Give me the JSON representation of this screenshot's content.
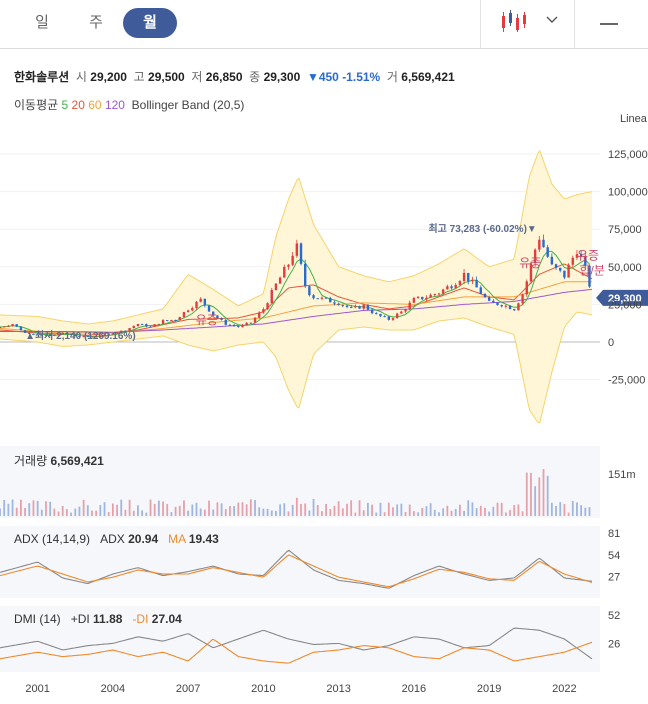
{
  "tabs": [
    {
      "label": "일",
      "active": false
    },
    {
      "label": "주",
      "active": false
    },
    {
      "label": "월",
      "active": true
    }
  ],
  "info": {
    "name": "한화솔루션",
    "open_label": "시",
    "open": "29,200",
    "high_label": "고",
    "high": "29,500",
    "low_label": "저",
    "low": "26,850",
    "close_label": "종",
    "close": "29,300",
    "change": "▼450",
    "change_pct": "-1.51%",
    "volume_label": "거",
    "volume": "6,569,421"
  },
  "ma": {
    "label": "이동평균",
    "periods": [
      "5",
      "20",
      "60",
      "120"
    ],
    "colors": [
      "#3cb44b",
      "#e6553a",
      "#f4a23c",
      "#9b59d0"
    ],
    "bollinger": "Bollinger Band (20,5)"
  },
  "scale_label": "Linea",
  "price_badge": "29,300",
  "volume_panel": {
    "label": "거래량",
    "value": "6,569,421"
  },
  "adx_panel": {
    "label": "ADX (14,14,9)",
    "adx_label": "ADX",
    "adx_value": "20.94",
    "ma_label": "MA",
    "ma_value": "19.43"
  },
  "dmi_panel": {
    "label": "DMI (14)",
    "pdi_label": "+DI",
    "pdi_value": "11.88",
    "mdi_label": "-DI",
    "mdi_value": "27.04"
  },
  "chart_data": [
    {
      "type": "line",
      "title": "",
      "x_ticks": [
        "2001",
        "2004",
        "2007",
        "2010",
        "2013",
        "2016",
        "2019",
        "2022"
      ],
      "y_ticks": [
        "125,000",
        "100,000",
        "75,000",
        "50,000",
        "25,000",
        "0",
        "-25,000"
      ],
      "ylim": [
        -30000,
        130000
      ],
      "annotations": [
        {
          "text": "최고 73,283 (-60.02%)▼",
          "x": 2020.9,
          "y": 73283
        },
        {
          "text": "▲최저 2,140 (1269.16%)",
          "x": 2000.5,
          "y": 2140
        },
        {
          "text": "유증",
          "x": 2007.3,
          "y": 12000
        },
        {
          "text": "유증",
          "x": 2020.2,
          "y": 50000
        },
        {
          "text": "유증",
          "x": 2022.5,
          "y": 55000
        },
        {
          "text": "합/분",
          "x": 2022.6,
          "y": 45000
        }
      ],
      "series": [
        {
          "name": "",
          "x": [
            1999.5,
            2000,
            2000.5,
            2001,
            2001.5,
            2002,
            2002.5,
            2003,
            2003.5,
            2004,
            2004.5,
            2005,
            2005.5,
            2006,
            2006.5,
            2007,
            2007.5,
            2008,
            2008.5,
            2009,
            2009.5,
            2010,
            2010.5,
            2011,
            2011.3,
            2011.7,
            2012,
            2012.5,
            2013,
            2013.5,
            2014,
            2014.5,
            2015,
            2015.5,
            2016,
            2016.5,
            2017,
            2017.5,
            2018,
            2018.5,
            2019,
            2019.5,
            2020,
            2020.4,
            2020.8,
            2021,
            2021.5,
            2022,
            2022.5,
            2022.8,
            2023,
            2023.1
          ],
          "values": [
            10000,
            12000,
            6000,
            5000,
            4000,
            6000,
            4000,
            3500,
            4000,
            6000,
            8000,
            12000,
            10000,
            14000,
            15000,
            22000,
            28000,
            18000,
            12000,
            10000,
            13000,
            22000,
            38000,
            52000,
            65000,
            35000,
            30000,
            28000,
            26000,
            22000,
            24000,
            18000,
            15000,
            20000,
            28000,
            30000,
            33000,
            38000,
            45000,
            36000,
            26000,
            25000,
            22000,
            34000,
            60000,
            70000,
            50000,
            44000,
            62000,
            50000,
            38000,
            29300
          ]
        },
        {
          "name": "",
          "x": [
            1999.5,
            2001,
            2003,
            2005,
            2007,
            2009,
            2010,
            2011,
            2012,
            2013,
            2014,
            2015,
            2016,
            2017,
            2018,
            2019,
            2020,
            2021,
            2022,
            2023.1
          ],
          "values": [
            8000,
            6000,
            4500,
            8000,
            15000,
            16000,
            20000,
            36000,
            38000,
            30000,
            25000,
            22000,
            24000,
            30000,
            36000,
            30000,
            28000,
            45000,
            52000,
            42000
          ]
        },
        {
          "name": "",
          "x": [
            1999.5,
            2002,
            2004,
            2006,
            2008,
            2010,
            2012,
            2014,
            2016,
            2018,
            2020,
            2022,
            2023.1
          ],
          "values": [
            9000,
            6000,
            6000,
            9000,
            13000,
            16000,
            24000,
            26000,
            25000,
            30000,
            30000,
            40000,
            40000
          ]
        },
        {
          "name": "",
          "x": [
            1999.5,
            2002,
            2004,
            2006,
            2008,
            2010,
            2012,
            2014,
            2016,
            2018,
            2020,
            2022,
            2023.1
          ],
          "values": [
            7000,
            7000,
            6500,
            8000,
            10000,
            12000,
            17000,
            21000,
            22000,
            25000,
            27000,
            33000,
            35000
          ]
        }
      ],
      "bollinger": {
        "x": [
          1999.5,
          2001,
          2002,
          2003,
          2004,
          2005,
          2006,
          2007,
          2008,
          2009,
          2010,
          2010.5,
          2011,
          2011.4,
          2012,
          2013,
          2014,
          2015,
          2016,
          2017,
          2018,
          2019,
          2020,
          2020.6,
          2021,
          2021.5,
          2022,
          2022.5,
          2023.1
        ],
        "upper": [
          18000,
          17000,
          14000,
          12000,
          14000,
          18000,
          22000,
          45000,
          35000,
          24000,
          32000,
          70000,
          95000,
          110000,
          78000,
          50000,
          44000,
          40000,
          44000,
          52000,
          62000,
          50000,
          55000,
          110000,
          128000,
          105000,
          95000,
          98000,
          100000
        ],
        "lower": [
          2000,
          0,
          -3000,
          -2000,
          0,
          2000,
          4000,
          -2000,
          -6000,
          -2000,
          0,
          -10000,
          -32000,
          -45000,
          -8000,
          8000,
          10000,
          8000,
          8000,
          14000,
          16000,
          10000,
          5000,
          -45000,
          -55000,
          -20000,
          10000,
          20000,
          18000
        ]
      }
    },
    {
      "type": "bar",
      "title": "",
      "series_name": "",
      "y_ticks": [
        "151m"
      ]
    },
    {
      "type": "line",
      "title": "",
      "y_ticks": [
        "81",
        "54",
        "27"
      ],
      "ylim": [
        0,
        90
      ],
      "series": [
        {
          "name": "ADX",
          "x": [
            1999.5,
            2001,
            2002,
            2003,
            2004,
            2005,
            2006,
            2007,
            2008,
            2009,
            2010,
            2011,
            2012,
            2013,
            2014,
            2015,
            2016,
            2017,
            2018,
            2019,
            2020,
            2021,
            2022,
            2023.1
          ],
          "values": [
            32,
            45,
            25,
            18,
            30,
            38,
            28,
            33,
            40,
            30,
            28,
            60,
            35,
            22,
            18,
            12,
            28,
            40,
            30,
            22,
            25,
            50,
            25,
            20.94
          ]
        },
        {
          "name": "MA",
          "x": [
            1999.5,
            2001,
            2002,
            2003,
            2004,
            2005,
            2006,
            2007,
            2008,
            2009,
            2010,
            2011,
            2012,
            2013,
            2014,
            2015,
            2016,
            2017,
            2018,
            2019,
            2020,
            2021,
            2022,
            2023.1
          ],
          "values": [
            28,
            40,
            30,
            20,
            26,
            35,
            30,
            30,
            38,
            32,
            26,
            54,
            40,
            26,
            20,
            14,
            24,
            36,
            32,
            24,
            22,
            46,
            30,
            19.43
          ]
        }
      ]
    },
    {
      "type": "line",
      "title": "",
      "y_ticks": [
        "52",
        "26"
      ],
      "ylim": [
        0,
        60
      ],
      "series": [
        {
          "name": "+DI",
          "x": [
            1999.5,
            2001,
            2002,
            2003,
            2004,
            2005,
            2006,
            2007,
            2008,
            2009,
            2010,
            2011,
            2012,
            2013,
            2014,
            2015,
            2016,
            2017,
            2018,
            2019,
            2020,
            2021,
            2022,
            2023.1
          ],
          "values": [
            22,
            28,
            20,
            24,
            26,
            32,
            28,
            35,
            22,
            30,
            38,
            30,
            25,
            26,
            20,
            24,
            32,
            30,
            22,
            24,
            40,
            38,
            30,
            11.88
          ]
        },
        {
          "name": "-DI",
          "x": [
            1999.5,
            2001,
            2002,
            2003,
            2004,
            2005,
            2006,
            2007,
            2008,
            2009,
            2010,
            2011,
            2012,
            2013,
            2014,
            2015,
            2016,
            2017,
            2018,
            2019,
            2020,
            2021,
            2022,
            2023.1
          ],
          "values": [
            12,
            18,
            14,
            16,
            20,
            14,
            18,
            10,
            30,
            14,
            10,
            8,
            18,
            20,
            24,
            22,
            14,
            12,
            22,
            20,
            10,
            14,
            18,
            27.04
          ]
        }
      ]
    }
  ]
}
